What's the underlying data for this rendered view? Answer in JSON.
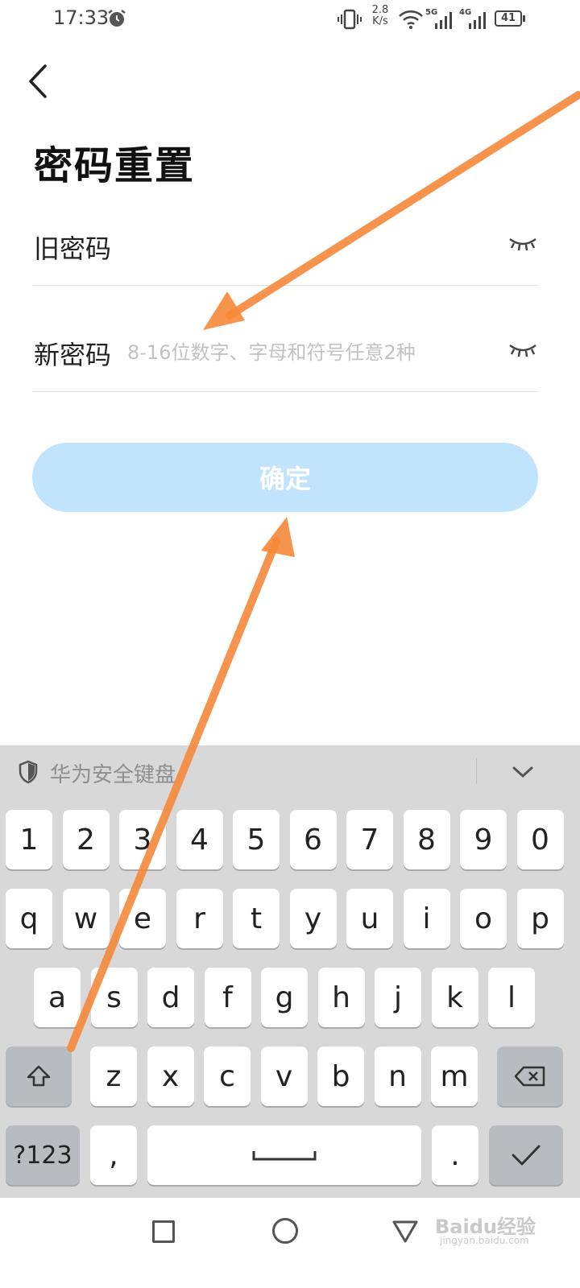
{
  "status_bar": {
    "time": "17:33",
    "net_speed_value": "2.8",
    "net_speed_unit": "K/s",
    "sig1_label": "5G",
    "sig2_label": "4G",
    "battery": "41"
  },
  "header": {
    "title": "密码重置"
  },
  "form": {
    "old_password_label": "旧密码",
    "new_password_label": "新密码",
    "new_password_placeholder": "8-16位数字、字母和符号任意2种",
    "confirm_label": "确定"
  },
  "keyboard": {
    "title": "华为安全键盘",
    "row_numbers": [
      "1",
      "2",
      "3",
      "4",
      "5",
      "6",
      "7",
      "8",
      "9",
      "0"
    ],
    "row_top": [
      "q",
      "w",
      "e",
      "r",
      "t",
      "y",
      "u",
      "i",
      "o",
      "p"
    ],
    "row_middle": [
      "a",
      "s",
      "d",
      "f",
      "g",
      "h",
      "j",
      "k",
      "l"
    ],
    "row_bottom": [
      "z",
      "x",
      "c",
      "v",
      "b",
      "n",
      "m"
    ],
    "mode_label": "?123",
    "comma": ",",
    "period": "."
  },
  "watermark": {
    "text": "Baidu经验",
    "sub": "jingyan.baidu.com"
  },
  "colors": {
    "accent_button": "#c2e3fc",
    "arrow_annotation": "#f5883a"
  }
}
